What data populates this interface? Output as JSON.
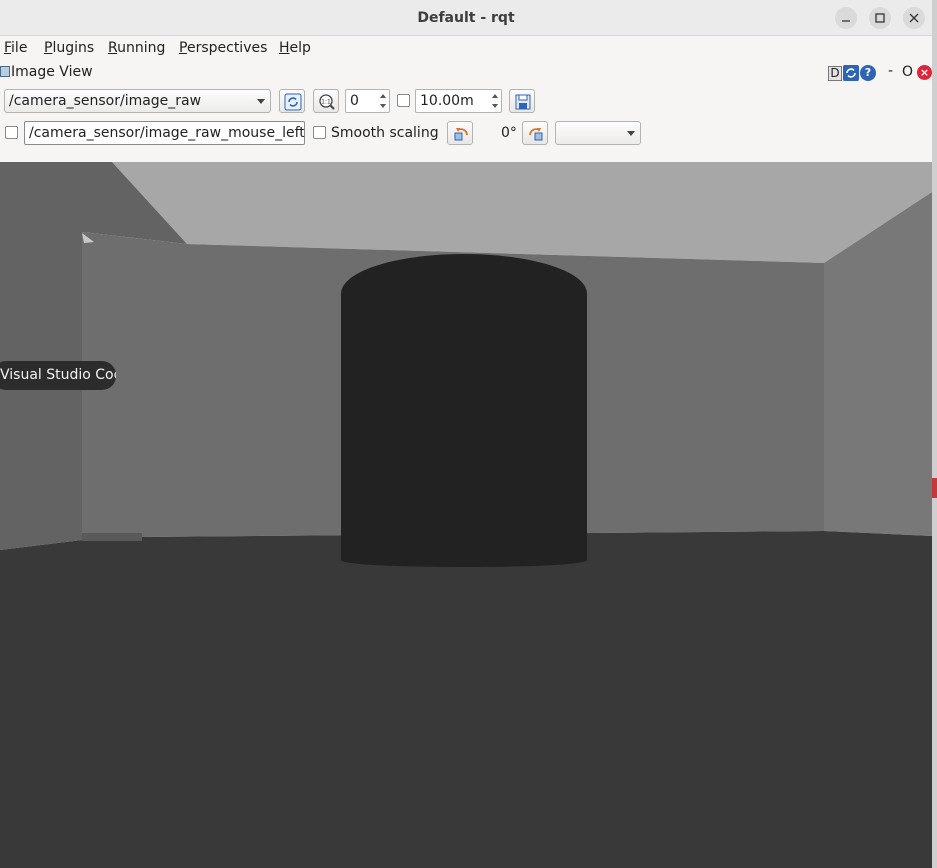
{
  "window": {
    "title": "Default - rqt",
    "controls": {
      "minimize": "minimize-icon",
      "maximize": "maximize-icon",
      "close": "close-icon"
    }
  },
  "menu": {
    "items": [
      {
        "mnemonic": "F",
        "rest": "ile"
      },
      {
        "mnemonic": "P",
        "rest": "lugins"
      },
      {
        "mnemonic": "R",
        "rest": "unning"
      },
      {
        "mnemonic": "P",
        "rest": "erspectives"
      },
      {
        "mnemonic": "H",
        "rest": "elp"
      }
    ]
  },
  "plugin": {
    "title": "Image View",
    "header_buttons": {
      "dock": "D",
      "minimize": "-",
      "options": "O",
      "help": "?"
    }
  },
  "toolbar": {
    "topic": "/camera_sensor/image_raw",
    "zoom_value": "0",
    "max_range": "10.00m",
    "mouse_topic": "/camera_sensor/image_raw_mouse_left",
    "smooth_scaling_label": "Smooth scaling",
    "rotation": "0°",
    "colormap": "",
    "smooth_scaling_checked": false,
    "mouse_publish_checked": false,
    "dynamic_range_checked": false
  },
  "overlay": {
    "dock_tooltip": "Visual Studio Code"
  },
  "colors": {
    "titlebar": "#ebebeb",
    "window_bg": "#f6f5f4",
    "close_red": "#e0243a",
    "help_blue": "#2e64b5",
    "scene_ceiling": "#a7a7a7",
    "scene_wall": "#6e6e6e",
    "scene_floor": "#393939",
    "scene_cylinder": "#222222"
  }
}
